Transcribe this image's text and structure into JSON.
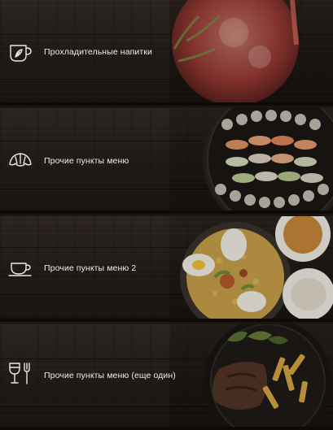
{
  "menu": {
    "items": [
      {
        "label": "Прохладительные напитки",
        "icon": "coffee-cup-leaf-icon"
      },
      {
        "label": "Прочие пункты меню",
        "icon": "croissant-icon"
      },
      {
        "label": "Прочие пункты меню 2",
        "icon": "tea-cup-icon"
      },
      {
        "label": "Прочие пункты меню (еще один)",
        "icon": "wine-glass-fork-icon"
      }
    ]
  },
  "colors": {
    "background": "#1f1915",
    "text": "#f2ede8"
  }
}
